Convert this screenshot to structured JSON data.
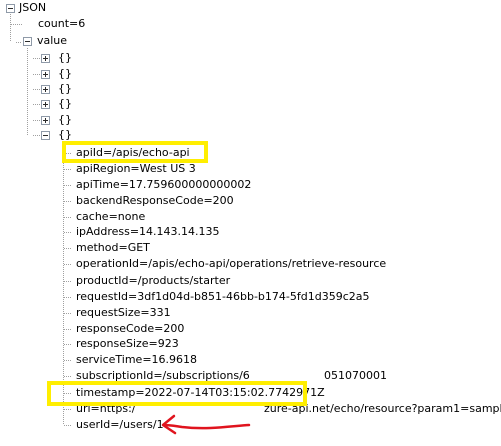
{
  "tree": {
    "root_label": "JSON",
    "count_label": "count=6",
    "value_label": "value",
    "objects": [
      "{}",
      "{}",
      "{}",
      "{}",
      "{}",
      "{}"
    ],
    "fields": [
      "apiId=/apis/echo-api",
      "apiRegion=West US 3",
      "apiTime=17.759600000000002",
      "backendResponseCode=200",
      "cache=none",
      "ipAddress=14.143.14.135",
      "method=GET",
      "operationId=/apis/echo-api/operations/retrieve-resource",
      "productId=/products/starter",
      "requestId=3df1d04d-b851-46bb-b174-5fd1d359c2a5",
      "requestSize=331",
      "responseCode=200",
      "responseSize=923",
      "serviceTime=16.9618",
      "subscriptionId=/subscriptions/6",
      "timestamp=2022-07-14T03:15:02.7742971Z",
      "url=https:/",
      "userId=/users/1"
    ],
    "subscription_tail": "051070001",
    "url_tail": "zure-api.net/echo/resource?param1=sample"
  },
  "colors": {
    "highlight": "#ffee00",
    "arrow": "#e0141e",
    "tree_line": "#a0a0a0"
  },
  "annotations": {
    "highlighted_fields": [
      "apiId",
      "timestamp"
    ],
    "arrow_target": "userId"
  }
}
